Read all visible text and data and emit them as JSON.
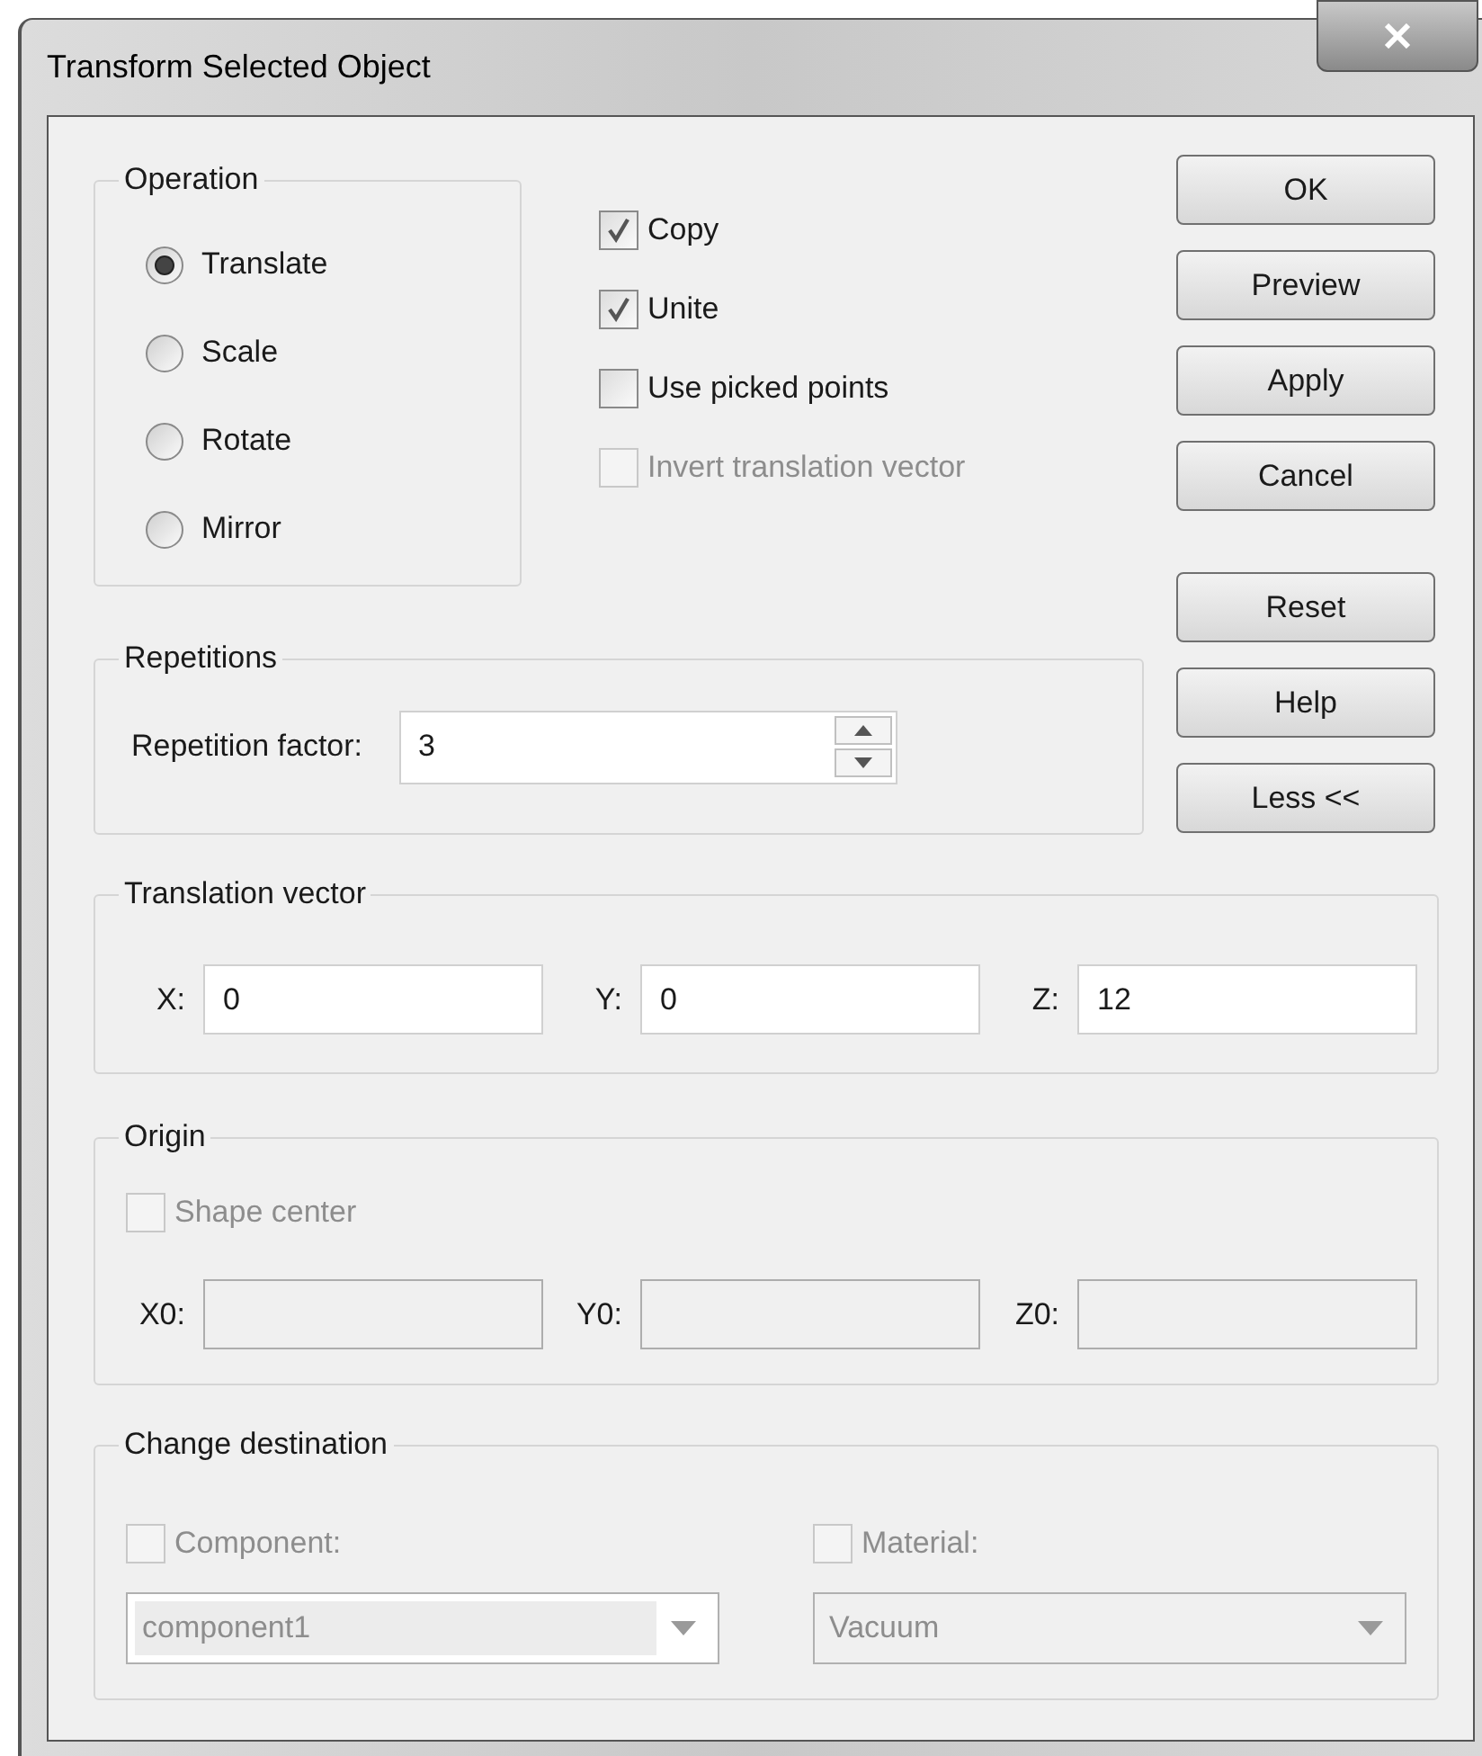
{
  "window": {
    "title": "Transform Selected Object"
  },
  "operation": {
    "legend": "Operation",
    "options": [
      {
        "label": "Translate",
        "selected": true
      },
      {
        "label": "Scale",
        "selected": false
      },
      {
        "label": "Rotate",
        "selected": false
      },
      {
        "label": "Mirror",
        "selected": false
      }
    ]
  },
  "checkboxes": [
    {
      "label": "Copy",
      "checked": true,
      "disabled": false
    },
    {
      "label": "Unite",
      "checked": true,
      "disabled": false
    },
    {
      "label": "Use picked points",
      "checked": false,
      "disabled": false
    },
    {
      "label": "Invert translation vector",
      "checked": false,
      "disabled": true
    }
  ],
  "button_groups": [
    {
      "buttons": [
        "OK",
        "Preview",
        "Apply",
        "Cancel"
      ]
    },
    {
      "buttons": [
        "Reset",
        "Help",
        "Less <<"
      ]
    }
  ],
  "repetitions": {
    "legend": "Repetitions",
    "label": "Repetition factor:",
    "value": "3"
  },
  "translation_vector": {
    "legend": "Translation vector",
    "fields": [
      {
        "label": "X:",
        "value": "0"
      },
      {
        "label": "Y:",
        "value": "0"
      },
      {
        "label": "Z:",
        "value": "12"
      }
    ]
  },
  "origin": {
    "legend": "Origin",
    "shape_center": {
      "label": "Shape center",
      "checked": false,
      "disabled": true
    },
    "fields": [
      {
        "label": "X0:",
        "disabled": true
      },
      {
        "label": "Y0:",
        "disabled": true
      },
      {
        "label": "Z0:",
        "disabled": true
      }
    ]
  },
  "change_destination": {
    "legend": "Change destination",
    "items": [
      {
        "label": "Component:",
        "checked": false,
        "disabled": true,
        "value": "component1"
      },
      {
        "label": "Material:",
        "checked": false,
        "disabled": true,
        "value": "Vacuum"
      }
    ]
  }
}
